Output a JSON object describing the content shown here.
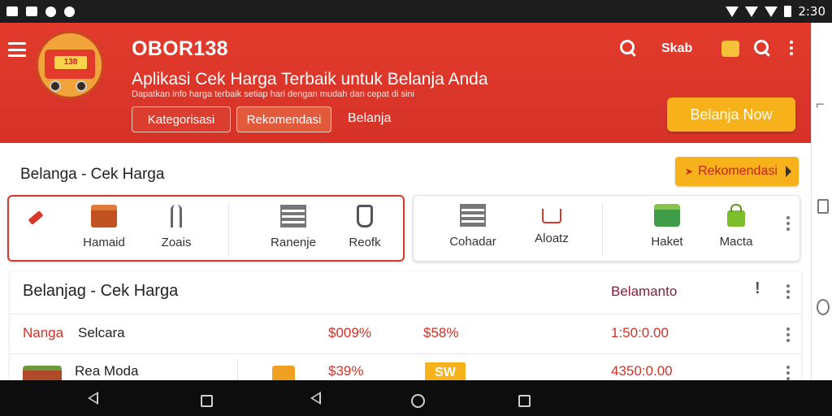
{
  "status_bar": {
    "time": "2:30",
    "left_icons": [
      "message-icon",
      "photo-icon",
      "shield-icon",
      "sync-icon"
    ],
    "right_icons": [
      "location-icon",
      "wifi-icon",
      "signal-icon",
      "battery-icon"
    ]
  },
  "header": {
    "menu_icon": "hamburger-menu-icon",
    "logo_text": "138",
    "app_name": "OBOR138",
    "tagline": "Aplikasi Cek Harga Terbaik untuk Belanja Anda",
    "subtitle": "Dapatkan info harga terbaik setiap hari dengan mudah dan cepat di sini",
    "buttons": [
      "Kategorisasi",
      "Rekomendasi"
    ],
    "tab": "Belanja",
    "link_label": "Skab",
    "promo_button": "Belanja Now",
    "action_icons": [
      "search-icon",
      "gift-icon",
      "search-icon",
      "more-vert-icon"
    ],
    "accent_color": "#E23B2C",
    "promo_color": "#F7B21B"
  },
  "section": {
    "title": "Belanga - Cek Harga",
    "rek_button": "Rekomendasi"
  },
  "categories": {
    "group1": [
      {
        "icon": "pin-icon",
        "label": ""
      },
      {
        "icon": "box-icon",
        "label": "Hamaid"
      },
      {
        "icon": "hanger-icon",
        "label": "Zoais"
      },
      {
        "icon": "list-icon",
        "label": "Ranenje"
      },
      {
        "icon": "cart-icon",
        "label": "Reofk"
      }
    ],
    "group2": [
      {
        "icon": "list-icon",
        "label": "Cohadar"
      },
      {
        "icon": "trolley-icon",
        "label": "Aloatz"
      },
      {
        "icon": "basket-icon",
        "label": "Haket"
      },
      {
        "icon": "bag-icon",
        "label": "Macta"
      }
    ]
  },
  "price_list": {
    "title": "Belanjag - Cek Harga",
    "link": "Belamanto",
    "rows": [
      {
        "accent": "Nanga",
        "name": "Selcara",
        "price1": "$009%",
        "price2": "$58%",
        "total": "1:50:0.00"
      },
      {
        "name": "Rea Moda",
        "price1": "$39%",
        "badge": "SW",
        "total": "4350:0.00"
      }
    ]
  },
  "nav_bar": {
    "buttons": [
      "back-icon",
      "home-icon",
      "back-icon",
      "circle-icon",
      "square-icon"
    ]
  }
}
